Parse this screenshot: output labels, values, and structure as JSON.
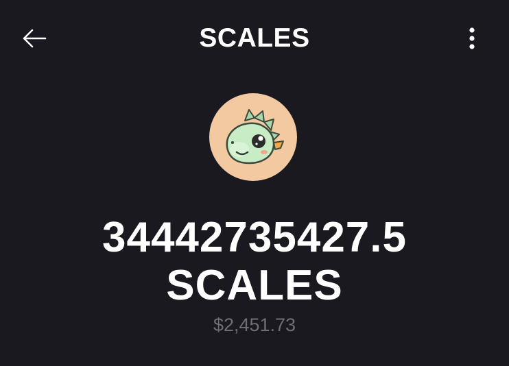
{
  "header": {
    "title": "SCALES",
    "back_icon": "arrow-left-icon",
    "more_icon": "more-vertical-icon"
  },
  "token": {
    "avatar_icon": "dragon-mascot-icon",
    "avatar_bg": "#f2c9a0",
    "amount": "34442735427.5",
    "symbol": "SCALES",
    "fiat_value": "$2,451.73"
  },
  "colors": {
    "background": "#1a191f",
    "text_primary": "#ffffff",
    "text_secondary": "#6e6e74"
  }
}
